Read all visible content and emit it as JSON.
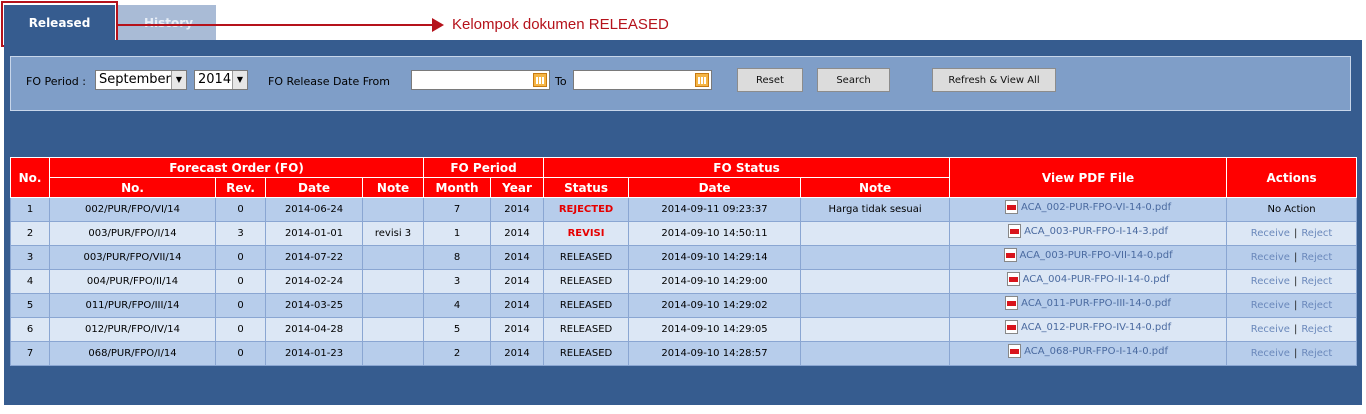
{
  "tabs": [
    {
      "label": "Released",
      "active": true
    },
    {
      "label": "History",
      "active": false
    }
  ],
  "annotation": "Kelompok dokumen RELEASED",
  "filter": {
    "period_label": "FO Period :",
    "month_value": "September",
    "year_value": "2014",
    "release_from_label": "FO Release Date From",
    "to_label": "To",
    "from_value": "",
    "to_value": "",
    "reset_label": "Reset",
    "search_label": "Search",
    "refresh_label": "Refresh & View All"
  },
  "table": {
    "header_groups": {
      "no": "No.",
      "fo": "Forecast Order (FO)",
      "period": "FO Period",
      "status": "FO Status",
      "pdf": "View PDF File",
      "actions": "Actions"
    },
    "sub_headers": [
      "No.",
      "Rev.",
      "Date",
      "Note",
      "Month",
      "Year",
      "Status",
      "Date",
      "Note"
    ],
    "rows": [
      {
        "n": "1",
        "fo_no": "002/PUR/FPO/VI/14",
        "rev": "0",
        "date": "2014-06-24",
        "note": "",
        "month": "7",
        "year": "2014",
        "status": "REJECTED",
        "status_date": "2014-09-11 09:23:37",
        "status_note": "Harga tidak sesuai",
        "pdf": "ACA_002-PUR-FPO-VI-14-0.pdf",
        "action": "No Action"
      },
      {
        "n": "2",
        "fo_no": "003/PUR/FPO/I/14",
        "rev": "3",
        "date": "2014-01-01",
        "note": "revisi 3",
        "month": "1",
        "year": "2014",
        "status": "REVISI",
        "status_date": "2014-09-10 14:50:11",
        "status_note": "",
        "pdf": "ACA_003-PUR-FPO-I-14-3.pdf",
        "action": ""
      },
      {
        "n": "3",
        "fo_no": "003/PUR/FPO/VII/14",
        "rev": "0",
        "date": "2014-07-22",
        "note": "",
        "month": "8",
        "year": "2014",
        "status": "RELEASED",
        "status_date": "2014-09-10 14:29:14",
        "status_note": "",
        "pdf": "ACA_003-PUR-FPO-VII-14-0.pdf",
        "action": ""
      },
      {
        "n": "4",
        "fo_no": "004/PUR/FPO/II/14",
        "rev": "0",
        "date": "2014-02-24",
        "note": "",
        "month": "3",
        "year": "2014",
        "status": "RELEASED",
        "status_date": "2014-09-10 14:29:00",
        "status_note": "",
        "pdf": "ACA_004-PUR-FPO-II-14-0.pdf",
        "action": ""
      },
      {
        "n": "5",
        "fo_no": "011/PUR/FPO/III/14",
        "rev": "0",
        "date": "2014-03-25",
        "note": "",
        "month": "4",
        "year": "2014",
        "status": "RELEASED",
        "status_date": "2014-09-10 14:29:02",
        "status_note": "",
        "pdf": "ACA_011-PUR-FPO-III-14-0.pdf",
        "action": ""
      },
      {
        "n": "6",
        "fo_no": "012/PUR/FPO/IV/14",
        "rev": "0",
        "date": "2014-04-28",
        "note": "",
        "month": "5",
        "year": "2014",
        "status": "RELEASED",
        "status_date": "2014-09-10 14:29:05",
        "status_note": "",
        "pdf": "ACA_012-PUR-FPO-IV-14-0.pdf",
        "action": ""
      },
      {
        "n": "7",
        "fo_no": "068/PUR/FPO/I/14",
        "rev": "0",
        "date": "2014-01-23",
        "note": "",
        "month": "2",
        "year": "2014",
        "status": "RELEASED",
        "status_date": "2014-09-10 14:28:57",
        "status_note": "",
        "pdf": "ACA_068-PUR-FPO-I-14-0.pdf",
        "action": ""
      }
    ],
    "action_receive": "Receive",
    "action_reject": "Reject",
    "action_sep": "|"
  },
  "colors": {
    "header_red": "#ff0000",
    "panel_blue": "#365c8f",
    "annotation": "#b5121b"
  },
  "icons": {
    "month_dropdown": "chevron-down-icon",
    "calendar": "calendar-icon",
    "pdf": "pdf-file-icon"
  }
}
